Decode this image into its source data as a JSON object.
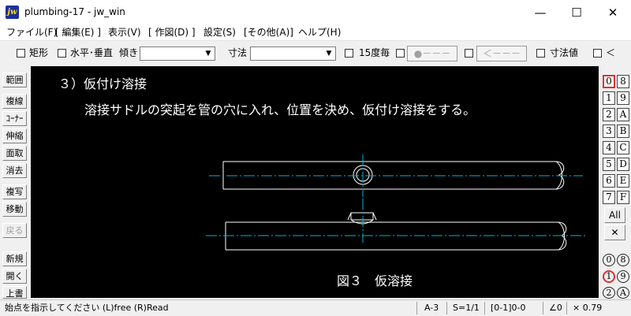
{
  "window": {
    "title": "plumbing-17 - jw_win",
    "icon_text": "jw",
    "minimize": "—",
    "maximize": "☐",
    "close": "✕"
  },
  "menu": [
    "ファイル(F)",
    "[ 編集(E) ]",
    "表示(V)",
    "[ 作図(D) ]",
    "設定(S)",
    "[その他(A)]",
    "ヘルプ(H)"
  ],
  "toolbar": {
    "rect_label": "矩形",
    "hv_label": "水平･垂直",
    "tilt_label": "傾き",
    "tilt_value": "",
    "dim_label": "寸法",
    "dim_value": "",
    "deg15_label": "15度毎",
    "btn_dot": "●－－－",
    "btn_arrow": "＜－－－",
    "dimval_label": "寸法値",
    "lt_label": "＜"
  },
  "left_tools": [
    "範囲",
    "複線",
    "ｺｰﾅｰ",
    "伸縮",
    "面取",
    "消去",
    "複写",
    "移動",
    "戻る",
    "新規",
    "開く",
    "上書"
  ],
  "canvas": {
    "heading": "３）仮付け溶接",
    "description": "溶接サドルの突起を管の穴に入れ、位置を決め、仮付け溶接をする。",
    "caption": "図３　仮溶接",
    "colors": {
      "background": "#000000",
      "line": "#ffffff",
      "center_line": "#00b4d8"
    }
  },
  "layers": {
    "grid_left": [
      "0",
      "1",
      "2",
      "3",
      "4",
      "5",
      "6",
      "7"
    ],
    "grid_right": [
      "8",
      "9",
      "A",
      "B",
      "C",
      "D",
      "E",
      "F"
    ],
    "active_layer": "0",
    "all_label": "All",
    "x_label": "✕",
    "groups_left": [
      "0",
      "1",
      "2"
    ],
    "groups_right": [
      "8",
      "9",
      "A"
    ],
    "active_group": "1"
  },
  "status": {
    "message": "始点を指示してください (L)free (R)Read",
    "paper": "A-3",
    "scale": "S=1/1",
    "layer": "[0-1]0-0",
    "angle": "∠0",
    "zoom": "× 0.79"
  }
}
